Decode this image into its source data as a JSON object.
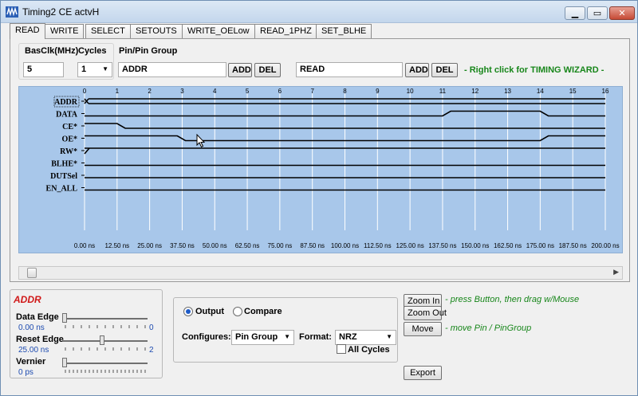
{
  "window": {
    "title": "Timing2 CE actvH"
  },
  "tabs": [
    "READ",
    "WRITE",
    "SELECT",
    "SETOUTS",
    "WRITE_OELow",
    "READ_1PHZ",
    "SET_BLHE"
  ],
  "active_tab": 0,
  "controls": {
    "basclk_label": "BasClk(MHz)",
    "cycles_label": "Cycles",
    "pin_group_label": "Pin/Pin Group",
    "basclk_value": "5",
    "cycles_value": "1",
    "pin_group_value": "ADDR",
    "add_label": "ADD",
    "del_label": "DEL",
    "timing_name_value": "READ",
    "add2_label": "ADD",
    "del2_label": "DEL",
    "wizard_hint": "- Right click for TIMING WIZARD -"
  },
  "chart_data": {
    "type": "timing-diagram",
    "top_ticks": [
      "0",
      "1",
      "2",
      "3",
      "4",
      "5",
      "6",
      "7",
      "8",
      "9",
      "10",
      "11",
      "12",
      "13",
      "14",
      "15",
      "16"
    ],
    "bottom_ticks": [
      "0.00 ns",
      "12.50 ns",
      "25.00 ns",
      "37.50 ns",
      "50.00 ns",
      "62.50 ns",
      "75.00 ns",
      "87.50 ns",
      "100.00 ns",
      "112.50 ns",
      "125.00 ns",
      "137.50 ns",
      "150.00 ns",
      "162.50 ns",
      "175.00 ns",
      "187.50 ns",
      "200.00 ns"
    ],
    "x_range": [
      0,
      16
    ],
    "signals": [
      {
        "name": "ADDR",
        "selected": true,
        "kind": "bus",
        "transitions": [
          0
        ]
      },
      {
        "name": "DATA",
        "steps": [
          [
            0,
            0
          ],
          [
            11.0,
            0
          ],
          [
            11.25,
            1
          ],
          [
            14.0,
            1
          ],
          [
            14.25,
            0
          ],
          [
            16,
            0
          ]
        ]
      },
      {
        "name": "CE*",
        "steps": [
          [
            0,
            1
          ],
          [
            1.0,
            1
          ],
          [
            1.25,
            0
          ],
          [
            16,
            0
          ]
        ]
      },
      {
        "name": "OE*",
        "steps": [
          [
            0,
            1
          ],
          [
            2.85,
            1
          ],
          [
            3.1,
            0
          ],
          [
            14.0,
            0
          ],
          [
            14.25,
            1
          ],
          [
            16,
            1
          ]
        ]
      },
      {
        "name": "RW*",
        "steps": [
          [
            0,
            1
          ],
          [
            16,
            1
          ]
        ],
        "edge_at_start": true
      },
      {
        "name": "BLHE*",
        "steps": [
          [
            0,
            0
          ],
          [
            16,
            0
          ]
        ]
      },
      {
        "name": "DUTSel",
        "steps": [
          [
            0,
            0
          ],
          [
            16,
            0
          ]
        ]
      },
      {
        "name": "EN_ALL",
        "steps": [
          [
            0,
            0
          ],
          [
            16,
            0
          ]
        ]
      }
    ],
    "colors": {
      "background": "#a8c7ea",
      "signal_line": "#000000",
      "selected_label": "#000000"
    }
  },
  "bottom": {
    "selected_pin": "ADDR",
    "data_edge_label": "Data Edge",
    "data_edge_value": "0.00 ns",
    "data_edge_max": "0",
    "reset_edge_label": "Reset Edge",
    "reset_edge_value": "25.00 ns",
    "reset_edge_max": "2",
    "vernier_label": "Vernier",
    "vernier_value": "0 ps",
    "output_label": "Output",
    "compare_label": "Compare",
    "configures_label": "Configures:",
    "configures_value": "Pin Group",
    "format_label": "Format:",
    "format_value": "NRZ",
    "all_cycles_label": "All Cycles",
    "zoom_in_label": "Zoom In",
    "zoom_out_label": "Zoom Out",
    "zoom_hint": "- press Button, then drag w/Mouse",
    "move_label": "Move",
    "move_hint": "- move Pin / PinGroup",
    "export_label": "Export"
  },
  "colors": {
    "accent_red": "#d01818",
    "hint_green": "#17861a",
    "value_blue": "#1d4bb0"
  }
}
